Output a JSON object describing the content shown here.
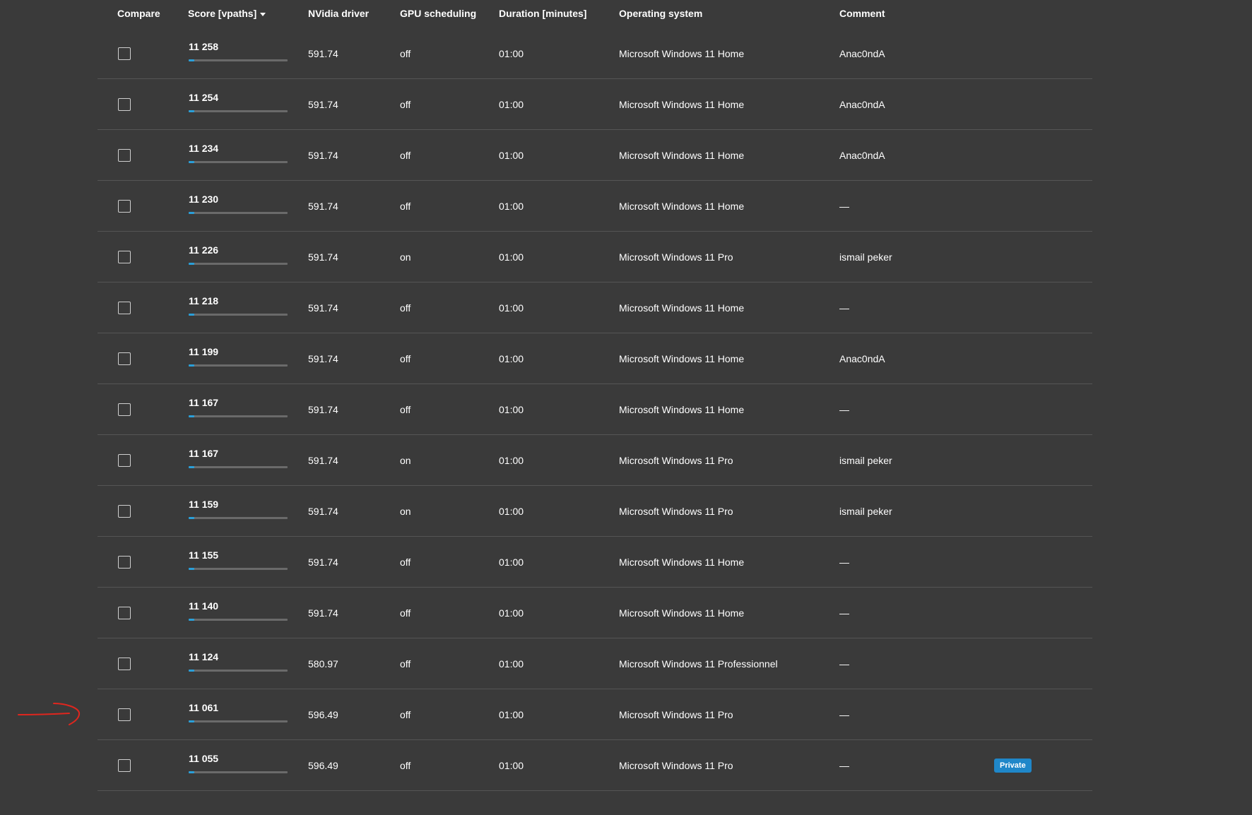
{
  "header": {
    "compare": "Compare",
    "score": "Score [vpaths]",
    "driver": "NVidia driver",
    "gpu_scheduling": "GPU scheduling",
    "duration": "Duration [minutes]",
    "os": "Operating system",
    "comment": "Comment"
  },
  "colors": {
    "background": "#3a3a3a",
    "accent": "#2a9fd8",
    "badge": "#1f87c9",
    "annotation": "#e0261e"
  },
  "rows": [
    {
      "score": "11 258",
      "score_fraction": 0.06,
      "driver": "591.74",
      "gpu": "off",
      "duration": "01:00",
      "os": "Microsoft Windows 11 Home",
      "comment": "Anac0ndA",
      "badge": ""
    },
    {
      "score": "11 254",
      "score_fraction": 0.06,
      "driver": "591.74",
      "gpu": "off",
      "duration": "01:00",
      "os": "Microsoft Windows 11 Home",
      "comment": "Anac0ndA",
      "badge": ""
    },
    {
      "score": "11 234",
      "score_fraction": 0.06,
      "driver": "591.74",
      "gpu": "off",
      "duration": "01:00",
      "os": "Microsoft Windows 11 Home",
      "comment": "Anac0ndA",
      "badge": ""
    },
    {
      "score": "11 230",
      "score_fraction": 0.06,
      "driver": "591.74",
      "gpu": "off",
      "duration": "01:00",
      "os": "Microsoft Windows 11 Home",
      "comment": "—",
      "badge": ""
    },
    {
      "score": "11 226",
      "score_fraction": 0.06,
      "driver": "591.74",
      "gpu": "on",
      "duration": "01:00",
      "os": "Microsoft Windows 11 Pro",
      "comment": "ismail peker",
      "badge": ""
    },
    {
      "score": "11 218",
      "score_fraction": 0.06,
      "driver": "591.74",
      "gpu": "off",
      "duration": "01:00",
      "os": "Microsoft Windows 11 Home",
      "comment": "—",
      "badge": ""
    },
    {
      "score": "11 199",
      "score_fraction": 0.06,
      "driver": "591.74",
      "gpu": "off",
      "duration": "01:00",
      "os": "Microsoft Windows 11 Home",
      "comment": "Anac0ndA",
      "badge": ""
    },
    {
      "score": "11 167",
      "score_fraction": 0.06,
      "driver": "591.74",
      "gpu": "off",
      "duration": "01:00",
      "os": "Microsoft Windows 11 Home",
      "comment": "—",
      "badge": ""
    },
    {
      "score": "11 167",
      "score_fraction": 0.06,
      "driver": "591.74",
      "gpu": "on",
      "duration": "01:00",
      "os": "Microsoft Windows 11 Pro",
      "comment": "ismail peker",
      "badge": ""
    },
    {
      "score": "11 159",
      "score_fraction": 0.06,
      "driver": "591.74",
      "gpu": "on",
      "duration": "01:00",
      "os": "Microsoft Windows 11 Pro",
      "comment": "ismail peker",
      "badge": ""
    },
    {
      "score": "11 155",
      "score_fraction": 0.06,
      "driver": "591.74",
      "gpu": "off",
      "duration": "01:00",
      "os": "Microsoft Windows 11 Home",
      "comment": "—",
      "badge": ""
    },
    {
      "score": "11 140",
      "score_fraction": 0.06,
      "driver": "591.74",
      "gpu": "off",
      "duration": "01:00",
      "os": "Microsoft Windows 11 Home",
      "comment": "—",
      "badge": ""
    },
    {
      "score": "11 124",
      "score_fraction": 0.06,
      "driver": "580.97",
      "gpu": "off",
      "duration": "01:00",
      "os": "Microsoft Windows 11 Professionnel",
      "comment": "—",
      "badge": ""
    },
    {
      "score": "11 061",
      "score_fraction": 0.06,
      "driver": "596.49",
      "gpu": "off",
      "duration": "01:00",
      "os": "Microsoft Windows 11 Pro",
      "comment": "—",
      "badge": ""
    },
    {
      "score": "11 055",
      "score_fraction": 0.06,
      "driver": "596.49",
      "gpu": "off",
      "duration": "01:00",
      "os": "Microsoft Windows 11 Pro",
      "comment": "—",
      "badge": "Private"
    }
  ]
}
